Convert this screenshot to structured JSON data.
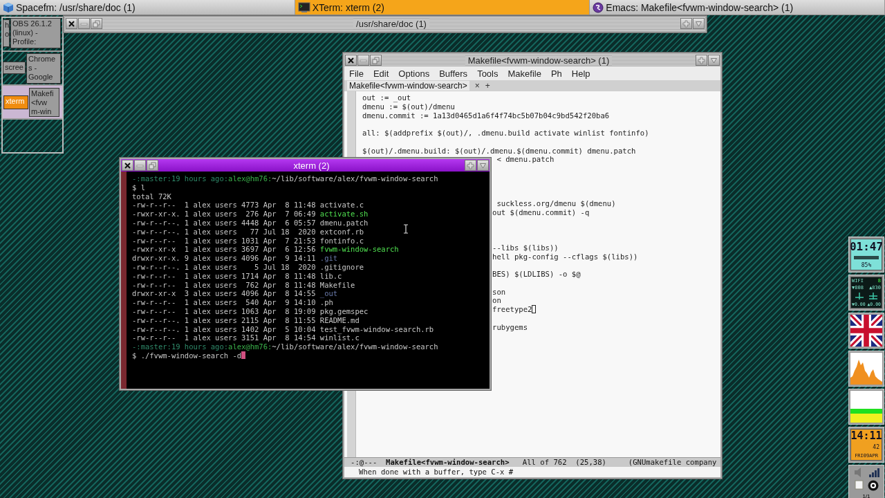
{
  "taskbar": [
    {
      "title": "Spacefm: /usr/share/doc (1)",
      "selected": false
    },
    {
      "title": "XTerm: xterm (2)",
      "selected": true
    },
    {
      "title": "Emacs: Makefile<fvwm-window-search> (1)",
      "selected": false
    }
  ],
  "pager": {
    "pages": [
      {
        "selected": false,
        "windows": [
          {
            "lines": [
              "h",
              "o"
            ],
            "focused": false
          },
          {
            "lines": [
              "OBS 26.1.2",
              "(linux) -",
              "Profile:"
            ],
            "focused": false
          }
        ]
      },
      {
        "selected": false,
        "windows": [
          {
            "lines": [
              "scree"
            ],
            "focused": false
          },
          {
            "lines": [
              "Chrome",
              "s -",
              "Google"
            ],
            "focused": false
          }
        ]
      },
      {
        "selected": true,
        "windows": [
          {
            "lines": [
              "xterm"
            ],
            "focused": true
          },
          {
            "lines": [
              "Makefi",
              "<fvw",
              "m-win"
            ],
            "focused": false
          }
        ]
      },
      {
        "selected": false
      }
    ]
  },
  "file_manager_window": {
    "title": "/usr/share/doc (1)"
  },
  "emacs_window": {
    "title": "Makefile<fvwm-window-search> (1)",
    "menu": [
      "File",
      "Edit",
      "Options",
      "Buffers",
      "Tools",
      "Makefile",
      "Ph",
      "Help"
    ],
    "tabs": [
      {
        "label": "Makefile<fvwm-window-search>",
        "close": "×",
        "selected": true
      }
    ],
    "new_tab": "+",
    "rows": [
      {
        "kind": "text",
        "text": "out := _out"
      },
      {
        "kind": "text",
        "text": "dmenu := $(out)/dmenu"
      },
      {
        "kind": "text",
        "text": "dmenu.commit := 1a13d0465d1a6f4f74bc5b07b04c9bd542f20ba6"
      },
      {
        "kind": "gap"
      },
      {
        "kind": "text",
        "text": "all: $(addprefix $(out)/, .dmenu.build activate winlist fontinfo)"
      },
      {
        "kind": "gap"
      },
      {
        "kind": "text",
        "text": "$(out)/.dmenu.build: $(out)/.dmenu.$(dmenu.commit) dmenu.patch"
      },
      {
        "kind": "fragment",
        "text": " < dmenu.patch"
      },
      {
        "kind": "gap"
      },
      {
        "kind": "gap"
      },
      {
        "kind": "gap"
      },
      {
        "kind": "gap"
      },
      {
        "kind": "fragment",
        "text": " suckless.org/dmenu $(dmenu)"
      },
      {
        "kind": "fragment",
        "text": "out $(dmenu.commit) -q"
      },
      {
        "kind": "gap"
      },
      {
        "kind": "gap"
      },
      {
        "kind": "gap"
      },
      {
        "kind": "fragment",
        "text": "--libs $(libs))"
      },
      {
        "kind": "fragment",
        "text": "hell pkg-config --cflags $(libs))"
      },
      {
        "kind": "gap"
      },
      {
        "kind": "fragment",
        "text": "BES) $(LDLIBS) -o $@"
      },
      {
        "kind": "gap"
      },
      {
        "kind": "fragment",
        "text": "son"
      },
      {
        "kind": "fragment",
        "text": "on"
      },
      {
        "kind": "fragment",
        "text": "freetype2",
        "cursor": true
      },
      {
        "kind": "gap"
      },
      {
        "kind": "fragment",
        "text": "rubygems"
      }
    ],
    "mode_line": "-:@---  **Makefile<fvwm-window-search>**   All of 762  (25,38)     (GNUmakefile company",
    "echo_area": "When done with a buffer, type C-x #"
  },
  "xterm_window": {
    "title": "xterm (2)",
    "lines": [
      {
        "kind": "prompt",
        "context": "-:master:19 hours ago:",
        "host": "alex@hm76:",
        "path": "~/lib/software/alex/fvwm-window-search"
      },
      {
        "kind": "command",
        "text": "$ l",
        "cursor": false
      },
      {
        "kind": "output",
        "text": "total 72K"
      },
      {
        "kind": "listing",
        "info": "-rw-r--r--  1 alex users 4773 Apr  8 11:48",
        "name": "activate.c"
      },
      {
        "kind": "listing",
        "info": "-rwxr-xr-x. 1 alex users  276 Apr  7 06:49",
        "name": "activate.sh",
        "color": "#50e050"
      },
      {
        "kind": "listing",
        "info": "-rw-r--r--. 1 alex users 4448 Apr  6 05:57",
        "name": "dmenu.patch"
      },
      {
        "kind": "listing",
        "info": "-rw-r--r--. 1 alex users   77 Jul 18  2020",
        "name": "extconf.rb"
      },
      {
        "kind": "listing",
        "info": "-rw-r--r--  1 alex users 1031 Apr  7 21:53",
        "name": "fontinfo.c"
      },
      {
        "kind": "listing",
        "info": "-rwxr-xr-x  1 alex users 3697 Apr  6 12:56",
        "name": "fvwm-window-search",
        "color": "#50e050"
      },
      {
        "kind": "listing",
        "info": "drwxr-xr-x. 9 alex users 4096 Apr  9 14:11",
        "name": ".git",
        "color": "#6a7aaa"
      },
      {
        "kind": "listing",
        "info": "-rw-r--r--. 1 alex users    5 Jul 18  2020",
        "name": ".gitignore"
      },
      {
        "kind": "listing",
        "info": "-rw-r--r--  1 alex users 1714 Apr  8 11:48",
        "name": "lib.c"
      },
      {
        "kind": "listing",
        "info": "-rw-r--r--  1 alex users  762 Apr  8 11:48",
        "name": "Makefile"
      },
      {
        "kind": "listing",
        "info": "drwxr-xr-x  3 alex users 4096 Apr  8 14:55",
        "name": "_out",
        "color": "#6a7aaa"
      },
      {
        "kind": "listing",
        "info": "-rw-r--r--  1 alex users  540 Apr  9 14:10",
        "name": ".ph"
      },
      {
        "kind": "listing",
        "info": "-rw-r--r--  1 alex users 1063 Apr  8 19:09",
        "name": "pkg.gemspec"
      },
      {
        "kind": "listing",
        "info": "-rw-r--r--. 1 alex users 2115 Apr  8 11:55",
        "name": "README.md"
      },
      {
        "kind": "listing",
        "info": "-rw-r--r--. 1 alex users 1402 Apr  5 10:04",
        "name": "test_fvwm-window-search.rb"
      },
      {
        "kind": "listing",
        "info": "-rw-r--r--  1 alex users 3151 Apr  8 14:54",
        "name": "winlist.c"
      },
      {
        "kind": "prompt",
        "context": "-:master:19 hours ago:",
        "host": "alex@hm76:",
        "path": "~/lib/software/alex/fvwm-window-search"
      },
      {
        "kind": "command",
        "text": "$ ./fvwm-window-search -d",
        "cursor": true
      }
    ]
  },
  "dock": [
    {
      "kind": "battery_clock",
      "time": "01:47",
      "battery": "85%"
    },
    {
      "kind": "wifi",
      "label": "WIFI",
      "strength": "8",
      "down": "▼808",
      "up": "▲830",
      "down_rate": "▼0.00",
      "up_rate": "▲0.00"
    },
    {
      "kind": "flag"
    },
    {
      "kind": "cpu_graph"
    },
    {
      "kind": "memory_bars"
    },
    {
      "kind": "clock",
      "time": "14:11",
      "seconds": "42",
      "date": "FRI09APR"
    },
    {
      "kind": "tray",
      "pages": "1/1"
    }
  ]
}
